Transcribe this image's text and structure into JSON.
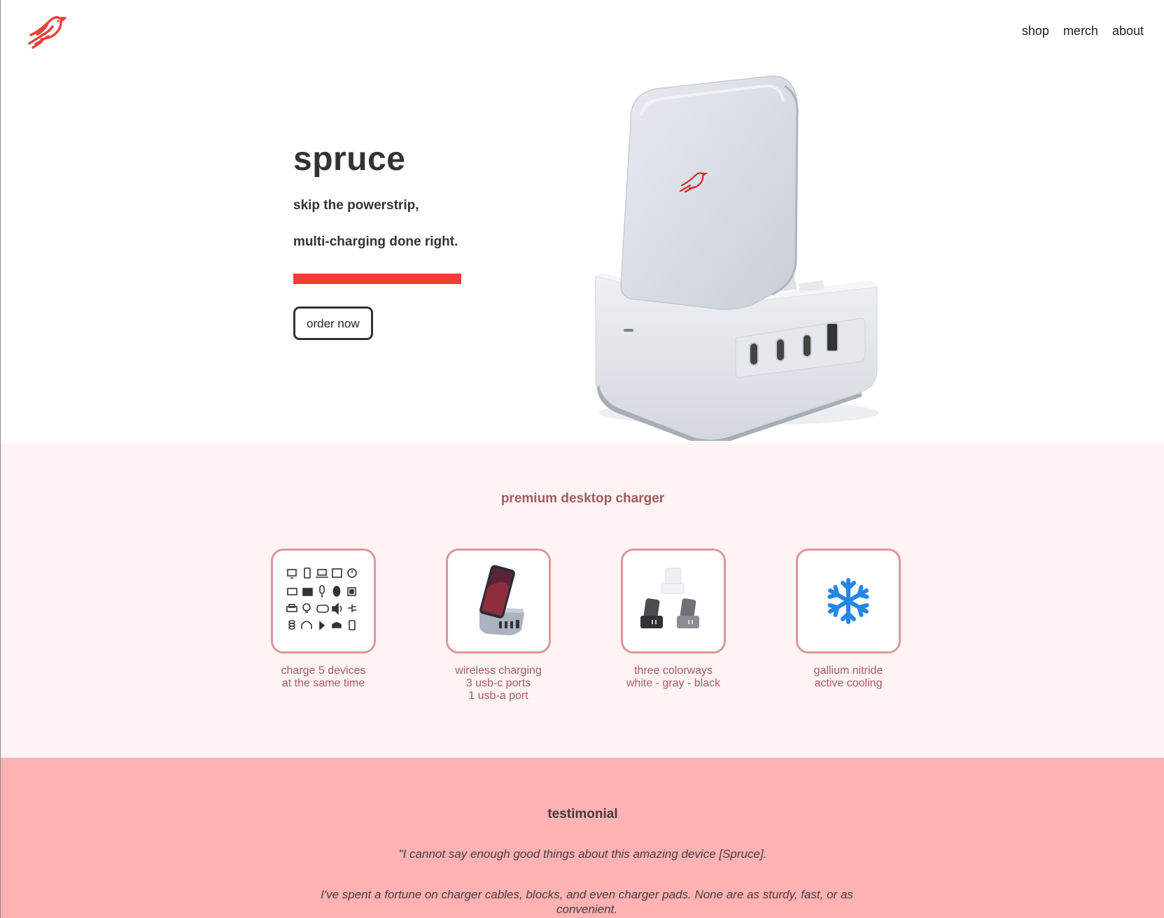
{
  "brand": {
    "logo_icon": "bird-logo-icon",
    "accent_color": "#ef3e36"
  },
  "nav": {
    "items": [
      "shop",
      "merch",
      "about"
    ]
  },
  "hero": {
    "title": "spruce",
    "subtitle_line1": "skip the powerstrip,",
    "subtitle_line2": "multi-charging done right.",
    "cta_label": "order now",
    "product_image": "charger-product-image"
  },
  "features": {
    "title": "premium desktop charger",
    "items": [
      {
        "icon": "device-grid-icon",
        "lines": [
          "charge 5 devices",
          "at the same time"
        ]
      },
      {
        "icon": "wireless-charging-image",
        "lines": [
          "wireless charging",
          "3 usb-c ports",
          "1 usb-a port"
        ]
      },
      {
        "icon": "colorways-image",
        "lines": [
          "three colorways",
          "white - gray - black"
        ]
      },
      {
        "icon": "snowflake-icon",
        "lines": [
          "gallium nitride",
          "active cooling"
        ]
      }
    ]
  },
  "testimonial": {
    "title": "testimonial",
    "quote_line1": "\"I cannot say enough good things about this amazing device [Spruce].",
    "quote_line2": "I've spent a fortune on charger cables, blocks, and even charger pads. None are as sturdy, fast, or as convenient."
  }
}
